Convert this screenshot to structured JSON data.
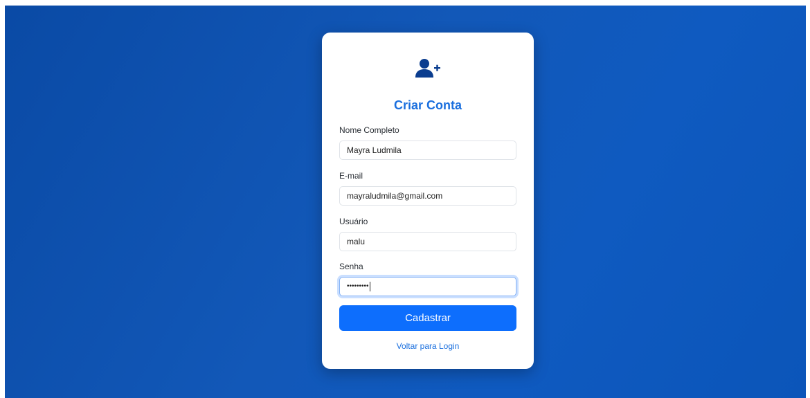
{
  "colors": {
    "accent": "#0d6efd",
    "title": "#1a6fde",
    "icon": "#0b3d8f",
    "background_start": "#0a4aa5",
    "background_end": "#0b55b9"
  },
  "card": {
    "icon": "user-plus-icon",
    "title": "Criar Conta"
  },
  "form": {
    "full_name": {
      "label": "Nome Completo",
      "value": "Mayra Ludmila"
    },
    "email": {
      "label": "E-mail",
      "value": "mayraludmila@gmail.com"
    },
    "username": {
      "label": "Usuário",
      "value": "malu"
    },
    "password": {
      "label": "Senha",
      "value": "•••••••••"
    }
  },
  "submit_label": "Cadastrar",
  "back_link_label": "Voltar para Login"
}
